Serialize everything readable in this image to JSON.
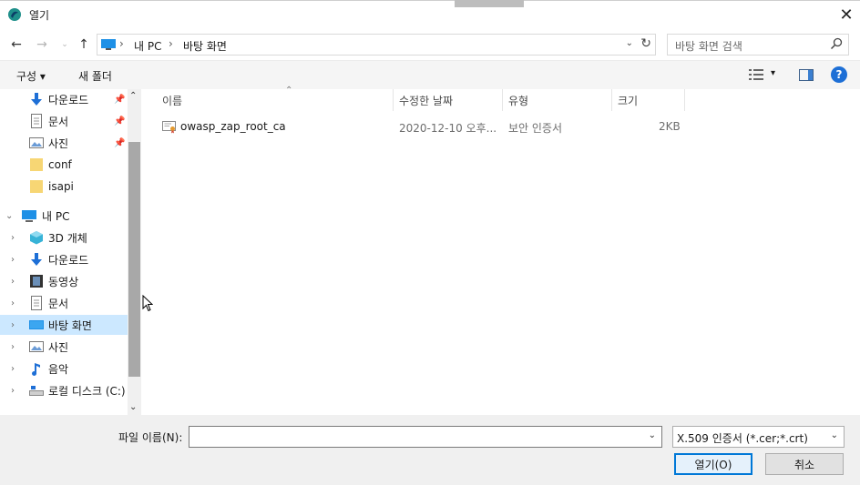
{
  "window": {
    "title": "열기",
    "close_glyph": "✕"
  },
  "address": {
    "crumbs": [
      "내 PC",
      "바탕 화면"
    ],
    "separator": "›",
    "search_placeholder": "바탕 화면 검색"
  },
  "toolbar": {
    "organize_label": "구성 ▾",
    "new_folder_label": "새 폴더",
    "help_label": "?"
  },
  "nav": {
    "items": [
      {
        "label": "다운로드",
        "icon": "download-arrow-icon",
        "pinned": true
      },
      {
        "label": "문서",
        "icon": "document-icon",
        "pinned": true
      },
      {
        "label": "사진",
        "icon": "pictures-icon",
        "pinned": true
      },
      {
        "label": "conf",
        "icon": "folder-icon",
        "pinned": false
      },
      {
        "label": "isapi",
        "icon": "folder-icon",
        "pinned": false
      },
      {
        "label": "내 PC",
        "icon": "pc-icon",
        "expanded": true
      },
      {
        "label": "3D 개체",
        "icon": "3d-objects-icon"
      },
      {
        "label": "다운로드",
        "icon": "download-arrow-icon"
      },
      {
        "label": "동영상",
        "icon": "video-icon"
      },
      {
        "label": "문서",
        "icon": "document-icon"
      },
      {
        "label": "바탕 화면",
        "icon": "desktop-icon",
        "selected": true
      },
      {
        "label": "사진",
        "icon": "pictures-icon"
      },
      {
        "label": "음악",
        "icon": "music-icon"
      },
      {
        "label": "로컬 디스크 (C:)",
        "icon": "local-disk-icon"
      }
    ]
  },
  "columns": {
    "name": "이름",
    "modified": "수정한 날짜",
    "type": "유형",
    "size": "크기"
  },
  "files": [
    {
      "name": "owasp_zap_root_ca",
      "modified": "2020-12-10 오후...",
      "type": "보안 인증서",
      "size": "2KB"
    }
  ],
  "bottom": {
    "filename_label": "파일 이름(N):",
    "filename_value": "",
    "filter_value": "X.509 인증서 (*.cer;*.crt)",
    "open_label": "열기(O)",
    "cancel_label": "취소"
  },
  "colors": {
    "selection": "#cce8ff",
    "accent": "#0078d7",
    "folder": "#f7d674"
  }
}
